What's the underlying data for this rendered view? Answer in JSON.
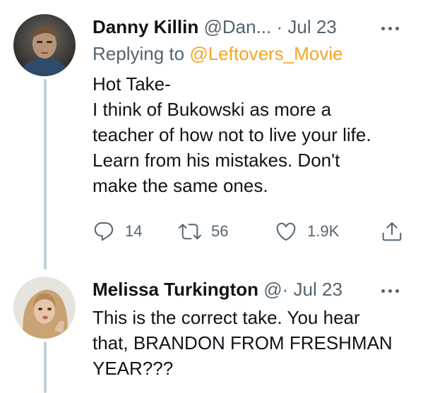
{
  "tweets": [
    {
      "name": "Danny Killin",
      "handle": "@Dan...",
      "separator": "·",
      "date": "Jul 23",
      "replying_prefix": "Replying to",
      "replying_to": "@Leftovers_Movie",
      "body_lines": [
        "Hot Take-",
        "I think of Bukowski as more a",
        "teacher of how not to live your life.",
        "Learn from his mistakes. Don't",
        "make the same ones."
      ],
      "actions": {
        "replies": "14",
        "retweets": "56",
        "likes": "1.9K"
      }
    },
    {
      "name": "Melissa Turkington",
      "handle": "@",
      "separator": "·",
      "date": "Jul 23",
      "body_lines": [
        "This is the correct take. You hear",
        "that, BRANDON FROM FRESHMAN",
        "YEAR???"
      ]
    }
  ],
  "colors": {
    "link": "#f5a623",
    "secondary_text": "#536471",
    "thread_line": "#c4cfd6"
  },
  "icons": [
    "reply-icon",
    "retweet-icon",
    "like-icon",
    "share-icon",
    "more-icon"
  ]
}
